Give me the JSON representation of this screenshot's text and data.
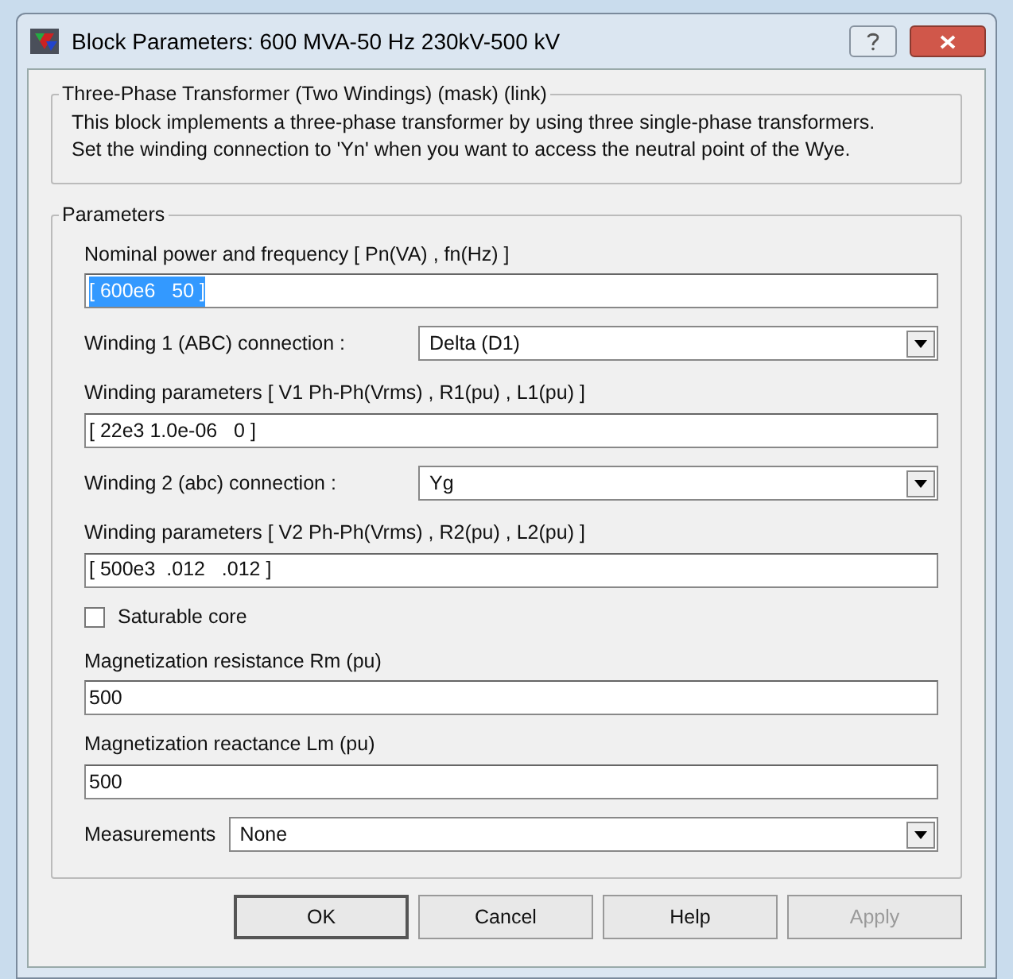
{
  "window": {
    "title": "Block Parameters: 600 MVA-50 Hz 230kV-500 kV"
  },
  "description": {
    "title": "Three-Phase Transformer (Two Windings) (mask) (link)",
    "text": "This block implements a three-phase transformer by using three single-phase transformers. Set the winding connection to 'Yn'  when you want to access the neutral point of the Wye."
  },
  "parameters": {
    "title": "Parameters",
    "items": [
      {
        "kind": "text",
        "label": "Nominal power and frequency  [ Pn(VA) , fn(Hz) ]",
        "value": "[ 600e6   50 ]",
        "selected": true
      },
      {
        "kind": "dropdown",
        "label": "Winding 1 (ABC) connection :",
        "value": "Delta (D1)"
      },
      {
        "kind": "text",
        "label": "Winding parameters [ V1 Ph-Ph(Vrms) , R1(pu) , L1(pu) ]",
        "value": "[ 22e3 1.0e-06   0 ]",
        "selected": false
      },
      {
        "kind": "dropdown",
        "label": "Winding 2 (abc) connection :",
        "value": "Yg"
      },
      {
        "kind": "text",
        "label": "Winding parameters [ V2 Ph-Ph(Vrms) , R2(pu) , L2(pu) ]",
        "value": "[ 500e3  .012   .012 ]",
        "selected": false
      },
      {
        "kind": "checkbox",
        "label": "Saturable core",
        "checked": false
      },
      {
        "kind": "text",
        "label": "Magnetization resistance  Rm (pu)",
        "value": "500",
        "selected": false
      },
      {
        "kind": "text",
        "label": "Magnetization reactance Lm (pu)",
        "value": "500",
        "selected": false
      },
      {
        "kind": "dropdown_inline",
        "label": "Measurements",
        "value": "None"
      }
    ]
  },
  "buttons": [
    {
      "label": "OK",
      "disabled": false
    },
    {
      "label": "Cancel",
      "disabled": false
    },
    {
      "label": "Help",
      "disabled": false
    },
    {
      "label": "Apply",
      "disabled": true
    }
  ]
}
